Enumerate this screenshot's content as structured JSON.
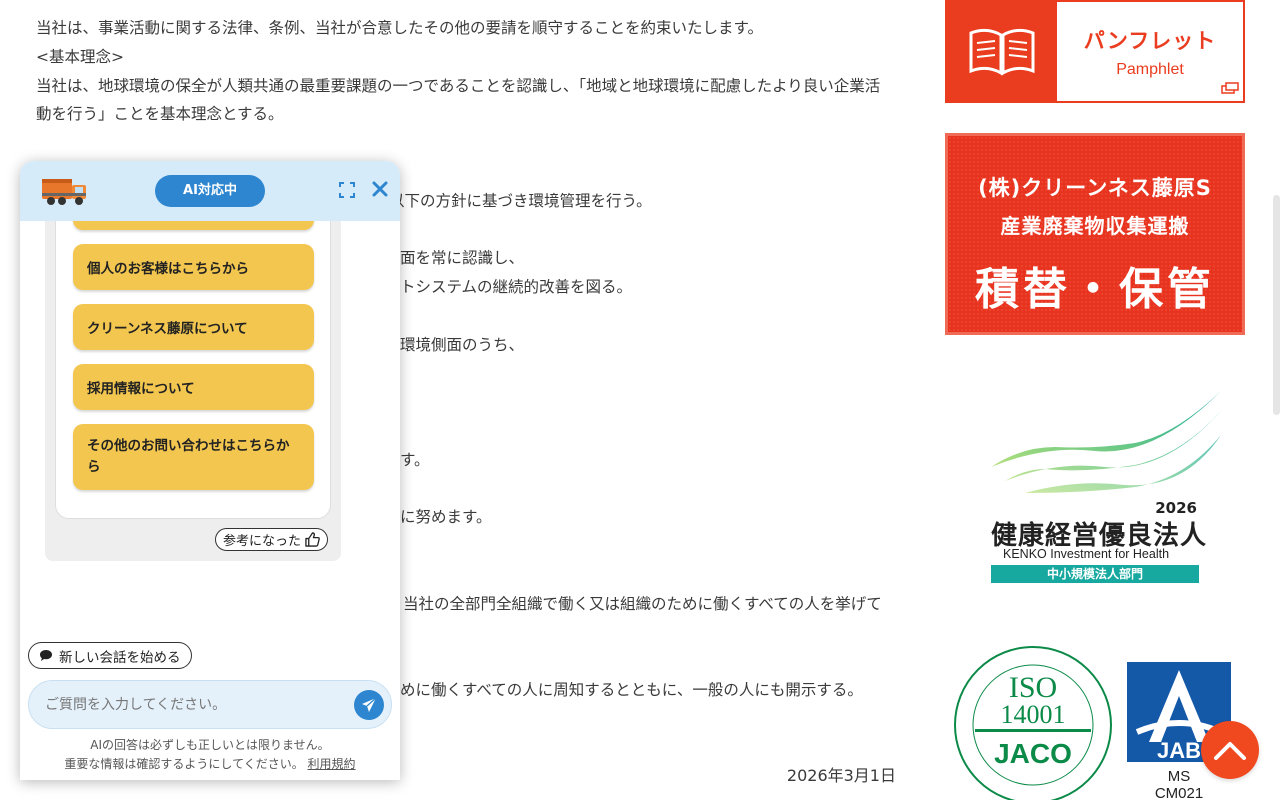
{
  "article": {
    "lines": [
      "当社は、事業活動に関する法律、条例、当社が合意したその他の要請を順守することを約束いたします。",
      "<基本理念>",
      "当社は、地球環境の保全が人類共通の最重要課題の一つであることを認識し、「地域と地球環境に配慮したより良い企業活",
      "動を行う」ことを基本理念とする。",
      "以下の方針に基づき環境管理を行う。",
      "面を常に認識し、",
      "トシステムの継続的改善を図る。",
      "環境側面のうち、",
      "す。",
      "に努めます。",
      "当社の全部門全組織で働く又は組織のために働くすべての人を挙げて",
      "めに働くすべての人に周知するとともに、一般の人にも開示する。"
    ],
    "date": "2026年3月1日"
  },
  "sidebar": {
    "pamphlet_jp": "パンフレット",
    "pamphlet_en": "Pamphlet",
    "banner_line1": "(株)クリーンネス藤原S",
    "banner_line2": "産業廃棄物収集運搬",
    "banner_line3": "積替・保管",
    "health_year": "2026",
    "health_title": "健康経営優良法人",
    "health_en": "KENKO Investment for Health",
    "health_category": "中小規模法人部門",
    "iso_text1": "ISO",
    "iso_text2": "14001",
    "iso_brand": "JACO",
    "jab_brand": "JAB",
    "jab_ms": "MS",
    "jab_code": "CM021"
  },
  "chat": {
    "status_label": "AI対応中",
    "options": [
      "個人のお客様はこちらから",
      "クリーンネス藤原について",
      "採用情報について",
      "その他のお問い合わせはこちらから"
    ],
    "helpful_label": "参考になった",
    "new_chat_label": "新しい会話を始める",
    "input_placeholder": "ご質問を入力してください。",
    "disclaimer_line1": "AIの回答は必ずしも正しいとは限りません。",
    "disclaimer_line2": "重要な情報は確認するようにしてください。",
    "terms_link": "利用規約"
  },
  "colors": {
    "accent_red": "#ea3c1e",
    "chat_blue": "#2d86cf",
    "option_yellow": "#f2c64f",
    "header_blue": "#d6ebfa",
    "teal": "#17a9a0"
  }
}
